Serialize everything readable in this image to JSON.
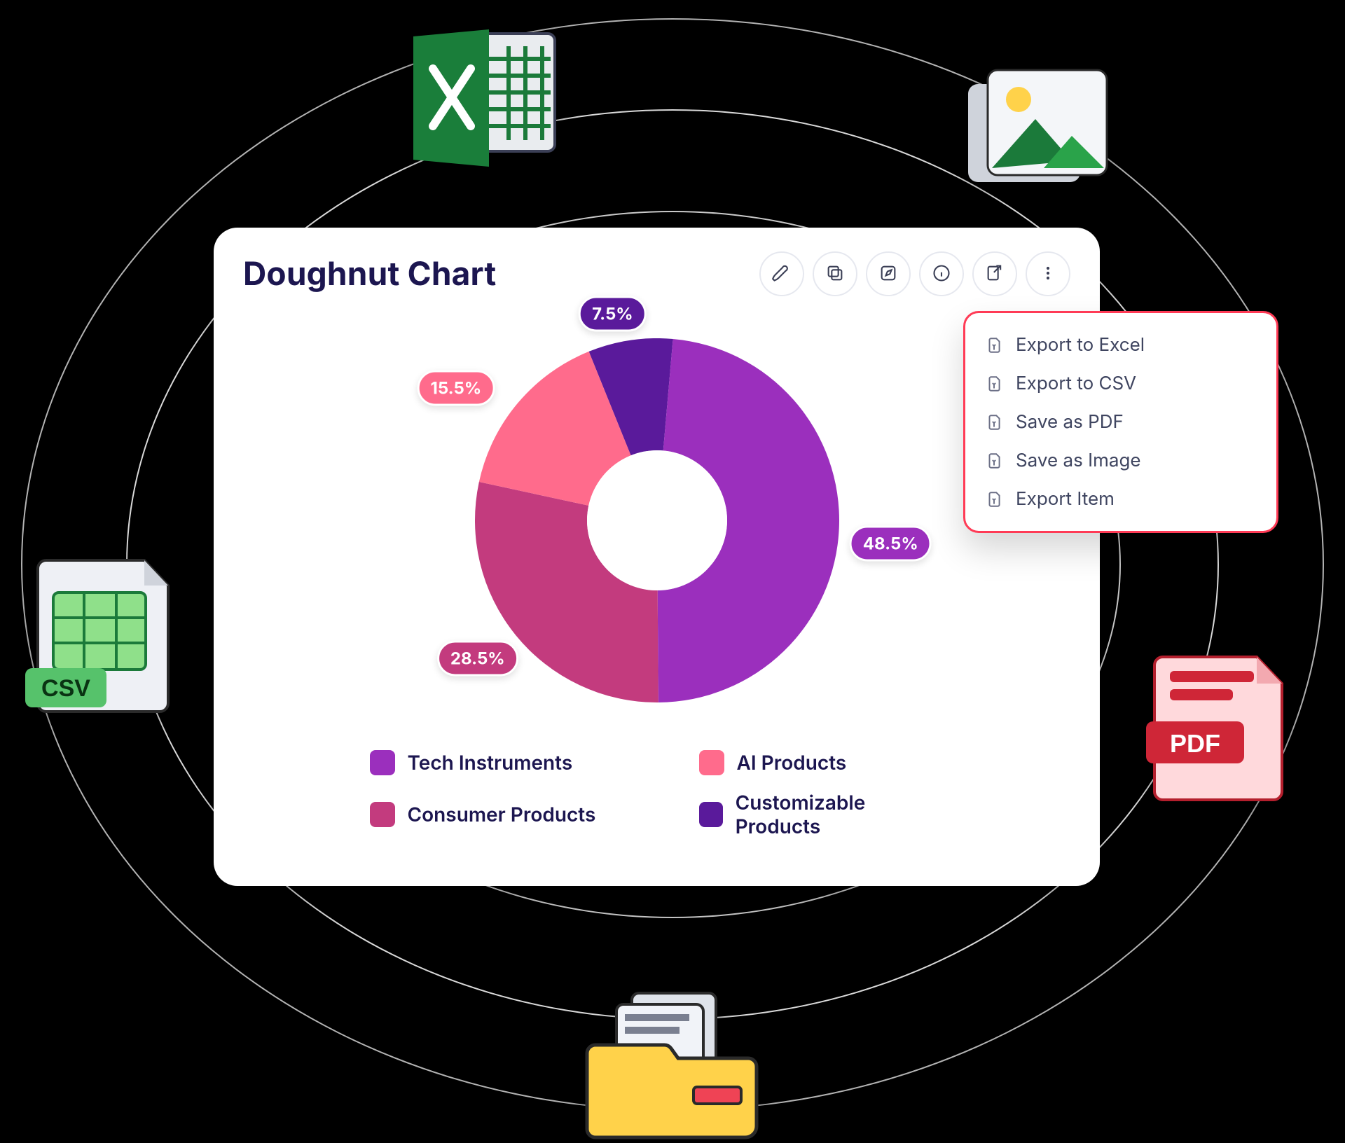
{
  "title": "Doughnut Chart",
  "colors": {
    "tech": "#9b2fbd",
    "ai": "#ff6b8c",
    "consumer": "#c33b7e",
    "custom": "#5a1a9b"
  },
  "toolbar_icons": {
    "pen": "pen-icon",
    "copy": "copy-icon",
    "edit": "edit-icon",
    "info": "info-icon",
    "export": "export-icon",
    "more": "more-icon"
  },
  "export_menu": {
    "items": [
      {
        "label": "Export to Excel"
      },
      {
        "label": "Export to CSV"
      },
      {
        "label": "Save as PDF"
      },
      {
        "label": "Save as Image"
      },
      {
        "label": "Export Item"
      }
    ]
  },
  "legend": [
    {
      "key": "tech",
      "label": "Tech Instruments",
      "color": "#9b2fbd"
    },
    {
      "key": "ai",
      "label": "AI Products",
      "color": "#ff6b8c"
    },
    {
      "key": "consumer",
      "label": "Consumer Products",
      "color": "#c33b7e"
    },
    {
      "key": "custom",
      "label": "Customizable Products",
      "color": "#5a1a9b"
    }
  ],
  "slice_labels": {
    "custom": "7.5%",
    "ai": "15.5%",
    "tech": "48.5%",
    "consumer": "28.5%"
  },
  "surrounding_icons": {
    "excel": "excel-file-icon",
    "image": "image-file-icon",
    "csv": "csv-file-icon",
    "pdf": "pdf-file-icon",
    "folder": "folder-icon"
  },
  "chart_data": {
    "type": "pie",
    "title": "Doughnut Chart",
    "categories": [
      "Tech Instruments",
      "Consumer Products",
      "AI Products",
      "Customizable Products"
    ],
    "values": [
      48.5,
      28.5,
      15.5,
      7.5
    ],
    "series_colors": [
      "#9b2fbd",
      "#c33b7e",
      "#ff6b8c",
      "#5a1a9b"
    ],
    "labels": [
      "48.5%",
      "28.5%",
      "15.5%",
      "7.5%"
    ],
    "donut_hole_ratio": 0.38
  }
}
